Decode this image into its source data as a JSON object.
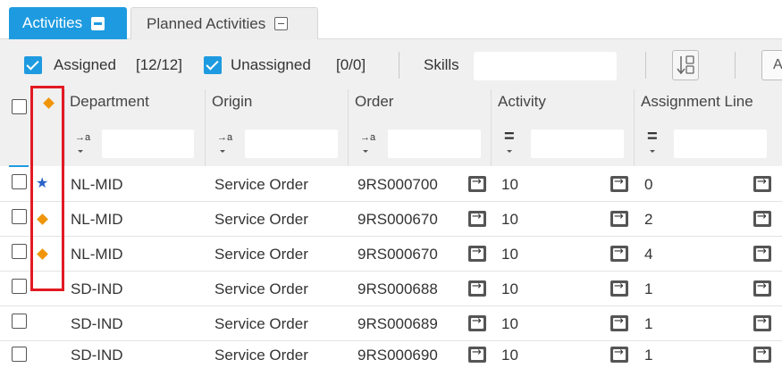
{
  "tabs": [
    {
      "label": "Activities",
      "active": true
    },
    {
      "label": "Planned Activities",
      "active": false
    }
  ],
  "toolbar": {
    "assigned_label": "Assigned",
    "assigned_count": "[12/12]",
    "unassigned_label": "Unassigned",
    "unassigned_count": "[0/0]",
    "skills_label": "Skills",
    "skills_value": "",
    "last_button_label": "A"
  },
  "columns": [
    {
      "key": "department",
      "label": "Department",
      "filter_op": "→a"
    },
    {
      "key": "origin",
      "label": "Origin",
      "filter_op": "→a"
    },
    {
      "key": "order",
      "label": "Order",
      "filter_op": "→a"
    },
    {
      "key": "activity",
      "label": "Activity",
      "filter_op": "="
    },
    {
      "key": "assignment_line",
      "label": "Assignment Line",
      "filter_op": "="
    }
  ],
  "rows": [
    {
      "marker": "star",
      "department": "NL-MID",
      "origin": "Service Order",
      "order": "9RS000700",
      "activity": "10",
      "assignment_line": "0"
    },
    {
      "marker": "diamond",
      "department": "NL-MID",
      "origin": "Service Order",
      "order": "9RS000670",
      "activity": "10",
      "assignment_line": "2"
    },
    {
      "marker": "diamond",
      "department": "NL-MID",
      "origin": "Service Order",
      "order": "9RS000670",
      "activity": "10",
      "assignment_line": "4"
    },
    {
      "marker": "none",
      "department": "SD-IND",
      "origin": "Service Order",
      "order": "9RS000688",
      "activity": "10",
      "assignment_line": "1"
    },
    {
      "marker": "none",
      "department": "SD-IND",
      "origin": "Service Order",
      "order": "9RS000689",
      "activity": "10",
      "assignment_line": "1"
    },
    {
      "marker": "none",
      "department": "SD-IND",
      "origin": "Service Order",
      "order": "9RS000690",
      "activity": "10",
      "assignment_line": "1"
    }
  ],
  "colors": {
    "accent": "#1e9be0",
    "diamond": "#f0950a",
    "star": "#2a62c9",
    "highlight": "#e21a22"
  }
}
